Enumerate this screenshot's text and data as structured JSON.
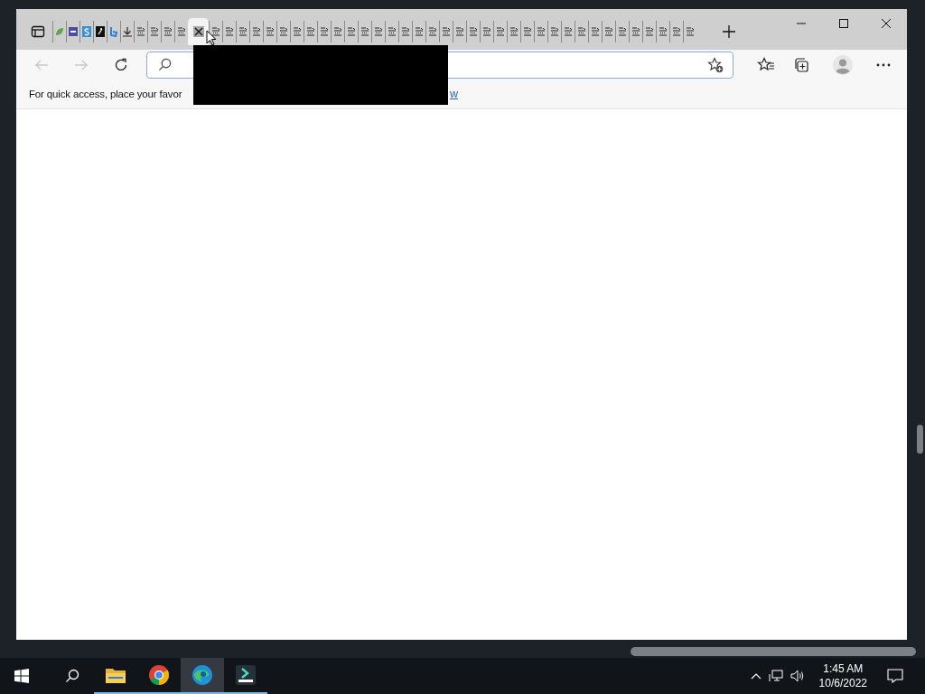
{
  "browser": {
    "tabs": [
      {
        "kind": "leaf",
        "selected": false
      },
      {
        "kind": "block",
        "selected": false
      },
      {
        "kind": "s",
        "selected": false
      },
      {
        "kind": "dark",
        "selected": false
      },
      {
        "kind": "b",
        "selected": false
      },
      {
        "kind": "download",
        "selected": false
      },
      {
        "kind": "doc",
        "selected": false
      },
      {
        "kind": "doc",
        "selected": false
      },
      {
        "kind": "doc",
        "selected": false
      },
      {
        "kind": "doc",
        "selected": false
      },
      {
        "kind": "close",
        "selected": true
      },
      {
        "kind": "doc",
        "selected": false
      },
      {
        "kind": "doc",
        "selected": false
      },
      {
        "kind": "doc",
        "selected": false
      },
      {
        "kind": "doc",
        "selected": false
      },
      {
        "kind": "doc",
        "selected": false
      },
      {
        "kind": "doc",
        "selected": false
      },
      {
        "kind": "doc",
        "selected": false
      },
      {
        "kind": "doc",
        "selected": false
      },
      {
        "kind": "doc",
        "selected": false
      },
      {
        "kind": "doc",
        "selected": false
      },
      {
        "kind": "doc",
        "selected": false
      },
      {
        "kind": "doc",
        "selected": false
      },
      {
        "kind": "doc",
        "selected": false
      },
      {
        "kind": "doc",
        "selected": false
      },
      {
        "kind": "doc",
        "selected": false
      },
      {
        "kind": "doc",
        "selected": false
      },
      {
        "kind": "doc",
        "selected": false
      },
      {
        "kind": "doc",
        "selected": false
      },
      {
        "kind": "doc",
        "selected": false
      },
      {
        "kind": "doc",
        "selected": false
      },
      {
        "kind": "doc",
        "selected": false
      },
      {
        "kind": "doc",
        "selected": false
      },
      {
        "kind": "doc",
        "selected": false
      },
      {
        "kind": "doc",
        "selected": false
      },
      {
        "kind": "doc",
        "selected": false
      },
      {
        "kind": "doc",
        "selected": false
      },
      {
        "kind": "doc",
        "selected": false
      },
      {
        "kind": "doc",
        "selected": false
      },
      {
        "kind": "doc",
        "selected": false
      },
      {
        "kind": "doc",
        "selected": false
      },
      {
        "kind": "doc",
        "selected": false
      },
      {
        "kind": "doc",
        "selected": false
      },
      {
        "kind": "doc",
        "selected": false
      },
      {
        "kind": "doc",
        "selected": false
      },
      {
        "kind": "doc",
        "selected": false
      },
      {
        "kind": "doc",
        "selected": false
      }
    ],
    "favorites_bar": {
      "text": "For quick access, place your favor",
      "link": "w"
    }
  },
  "taskbar": {
    "apps": [
      {
        "kind": "folder",
        "selected": false
      },
      {
        "kind": "chrome",
        "selected": false
      },
      {
        "kind": "edge",
        "selected": true
      },
      {
        "kind": "editor",
        "selected": false
      }
    ],
    "time": "1:45 AM",
    "date": "10/6/2022"
  }
}
